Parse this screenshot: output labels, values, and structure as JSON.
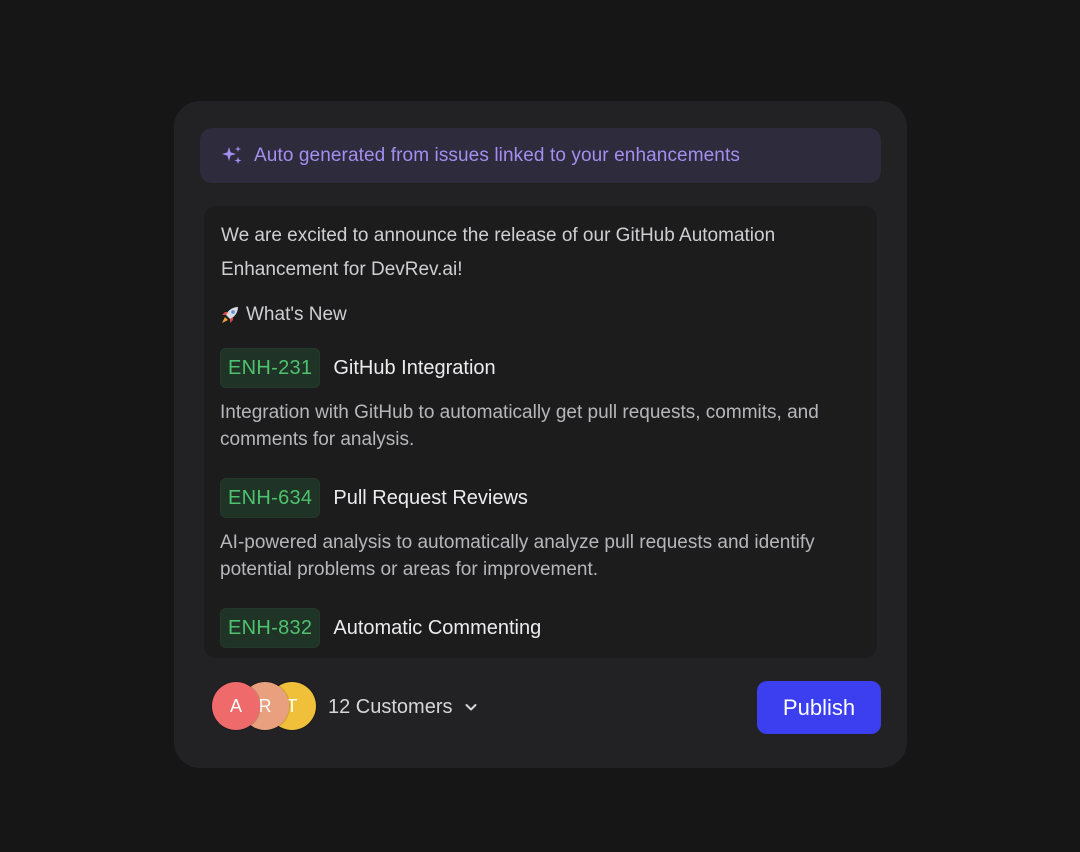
{
  "banner": {
    "text": "Auto generated from issues linked to your enhancements",
    "icon": "sparkles-icon",
    "color": "#a48ef0"
  },
  "intro": "We are excited to announce the release of our GitHub Automation Enhancement for DevRev.ai!",
  "whats_new": {
    "icon": "rocket-icon",
    "label": "What's New"
  },
  "items": [
    {
      "tag": "ENH-231",
      "title": "GitHub Integration",
      "description": "Integration with GitHub to automatically get pull requests, commits, and comments for analysis."
    },
    {
      "tag": "ENH-634",
      "title": "Pull Request Reviews",
      "description": "AI-powered analysis to automatically analyze pull requests and identify potential problems or areas for improvement."
    },
    {
      "tag": "ENH-832",
      "title": "Automatic Commenting",
      "description": ""
    }
  ],
  "footer": {
    "avatars": [
      {
        "initial": "A",
        "color": "#ef6b6b"
      },
      {
        "initial": "R",
        "color": "#e9a07e"
      },
      {
        "initial": "T",
        "color": "#f0c03a"
      }
    ],
    "customers_label": "12 Customers",
    "publish_label": "Publish"
  },
  "colors": {
    "accent": "#3b3ff0",
    "tag_text": "#4ec26d",
    "background": "#161617",
    "card": "#222224"
  }
}
